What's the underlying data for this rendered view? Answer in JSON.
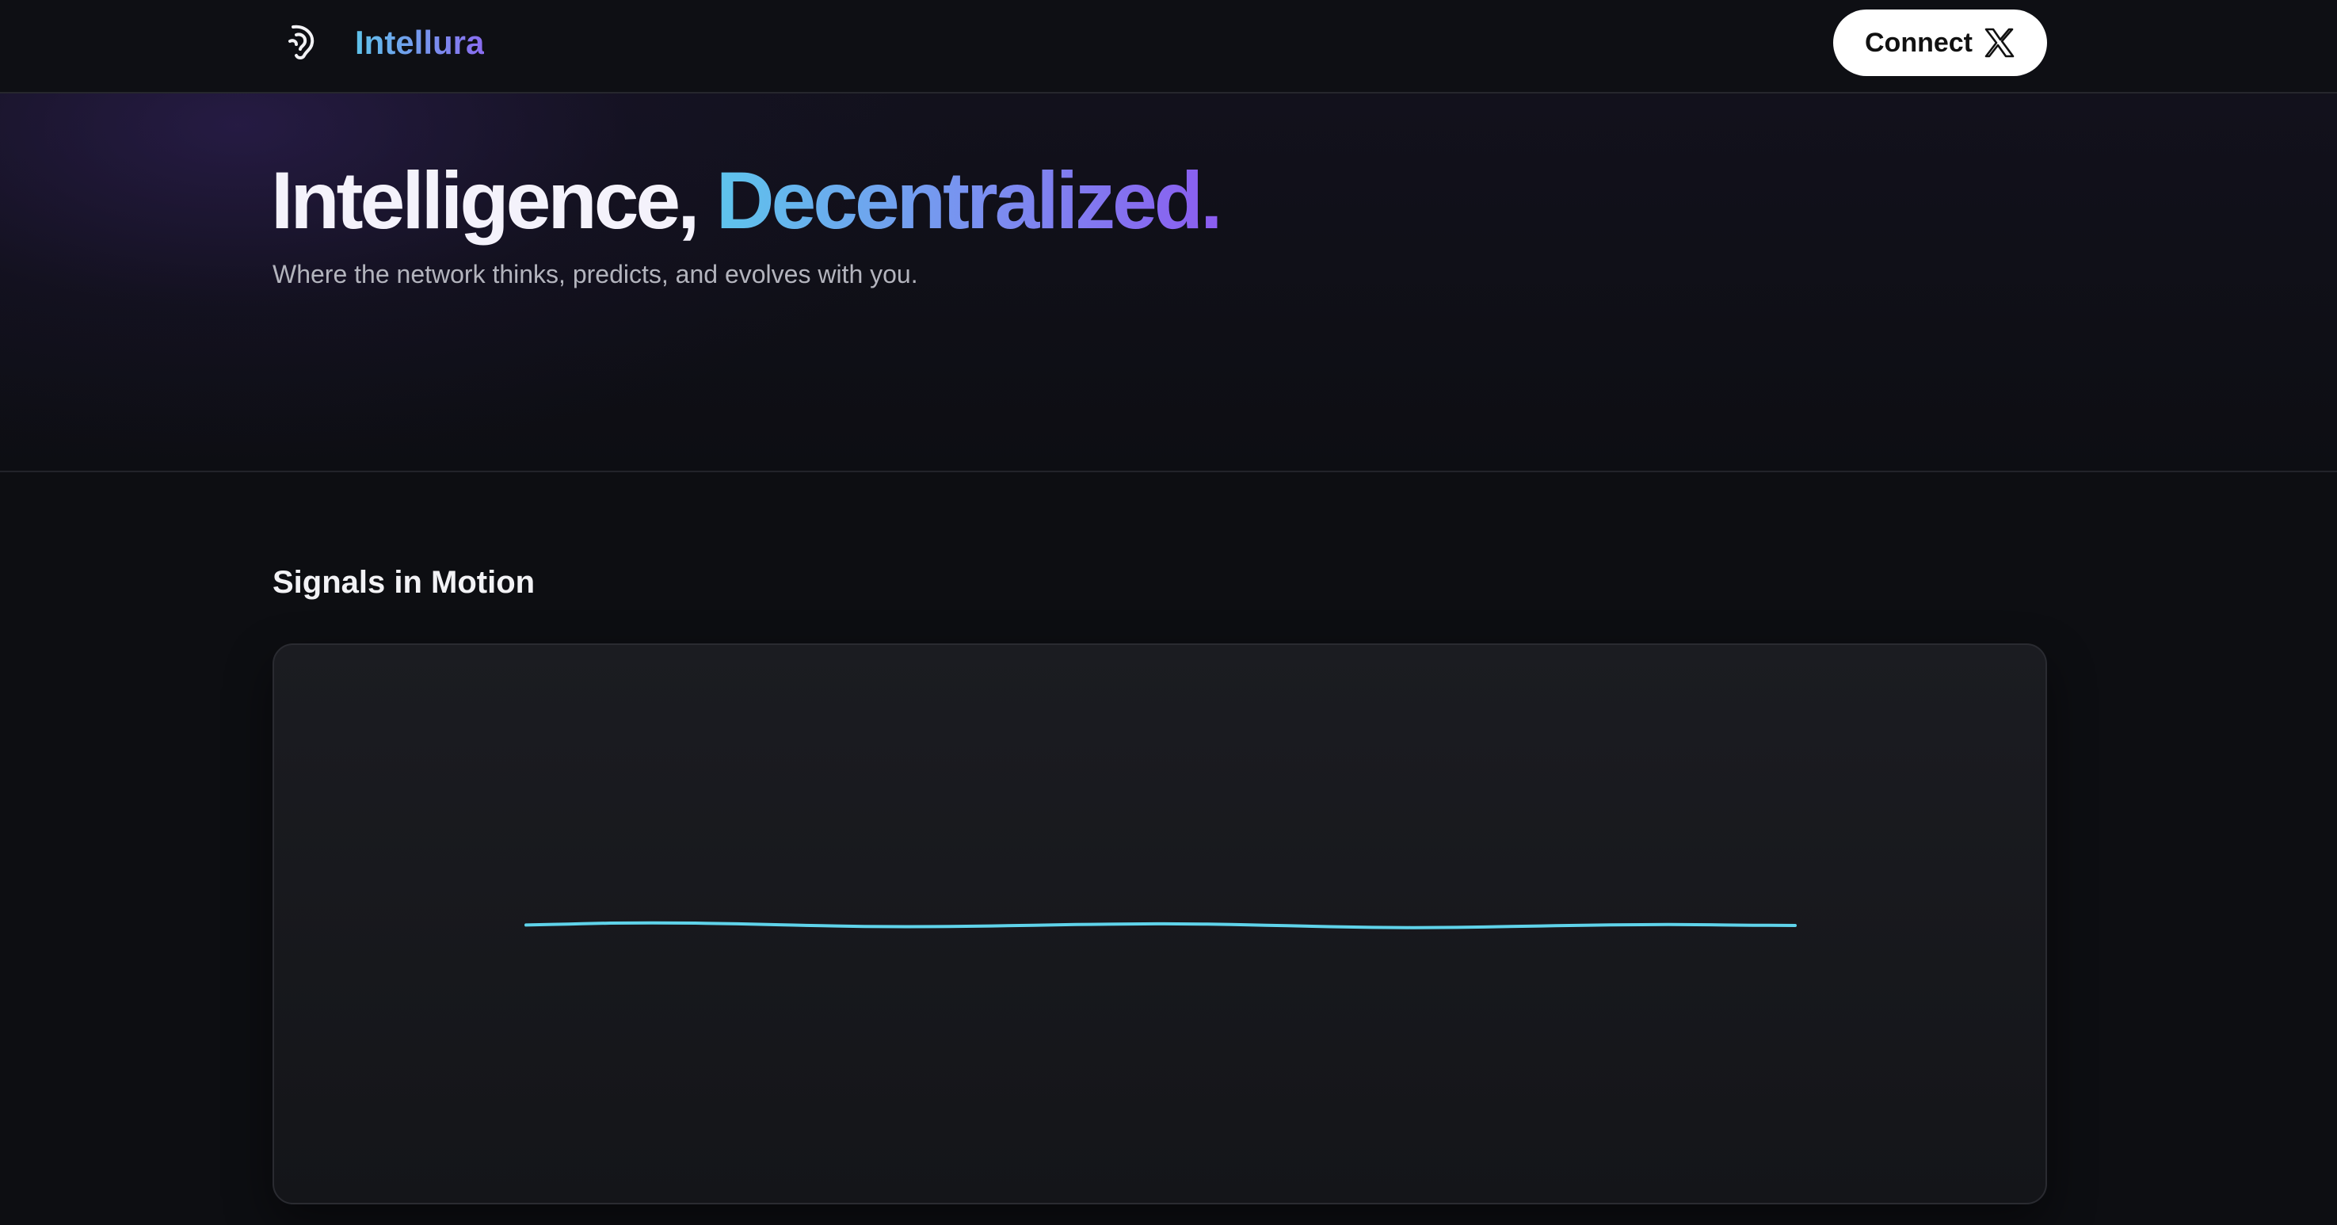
{
  "header": {
    "brand": "Intellura",
    "logo_icon": "ear-icon",
    "connect_label": "Connect",
    "connect_icon": "x-logo-icon"
  },
  "hero": {
    "title_plain": "Intelligence,",
    "title_accent": "Decentralized.",
    "subtitle": "Where the network thinks, predicts, and evolves with you."
  },
  "signals": {
    "title": "Signals in Motion"
  },
  "colors": {
    "background": "#0d0e12",
    "brand_gradient_start": "#5fc3ea",
    "brand_gradient_end": "#8a6cf0",
    "signal_line": "#5fd3ea",
    "card": "#17181c"
  },
  "chart_data": {
    "type": "line",
    "title": "",
    "xlabel": "",
    "ylabel": "",
    "grid": false,
    "legend": "none",
    "ylim": [
      -1,
      1
    ],
    "series": [
      {
        "values": [
          0.02,
          0.06,
          0.1,
          0.11,
          0.1,
          0.07,
          0.03,
          -0.01,
          -0.04,
          -0.05,
          -0.04,
          -0.02,
          0.01,
          0.04,
          0.06,
          0.07,
          0.06,
          0.03,
          -0.01,
          -0.05,
          -0.08,
          -0.09,
          -0.08,
          -0.05,
          -0.02,
          0.01,
          0.03,
          0.04,
          0.03,
          0.01,
          0.0
        ]
      }
    ]
  }
}
